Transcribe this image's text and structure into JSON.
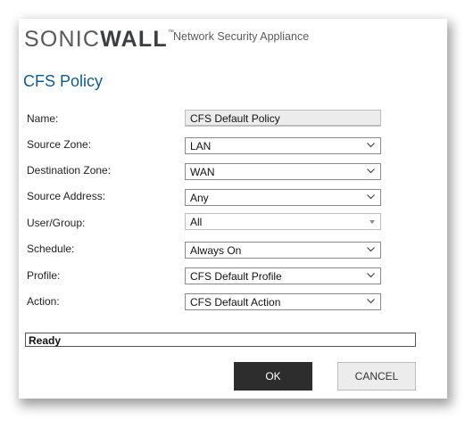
{
  "header": {
    "brand_light": "SONIC",
    "brand_bold": "WALL",
    "trademark": "™",
    "subtitle": "Network Security Appliance"
  },
  "dialog_title": "CFS Policy",
  "form": {
    "name": {
      "label": "Name:",
      "value": "CFS Default Policy"
    },
    "source_zone": {
      "label": "Source Zone:",
      "value": "LAN"
    },
    "destination_zone": {
      "label": "Destination Zone:",
      "value": "WAN"
    },
    "source_address": {
      "label": "Source Address:",
      "value": "Any"
    },
    "user_group": {
      "label": "User/Group:",
      "value": "All"
    },
    "schedule": {
      "label": "Schedule:",
      "value": "Always On"
    },
    "profile": {
      "label": "Profile:",
      "value": "CFS Default Profile"
    },
    "action": {
      "label": "Action:",
      "value": "CFS Default Action"
    }
  },
  "status_text": "Ready",
  "buttons": {
    "ok": "OK",
    "cancel": "CANCEL"
  },
  "colors": {
    "title": "#0f5d8b",
    "ok_bg": "#2d2d2d",
    "cancel_bg": "#ececec"
  }
}
